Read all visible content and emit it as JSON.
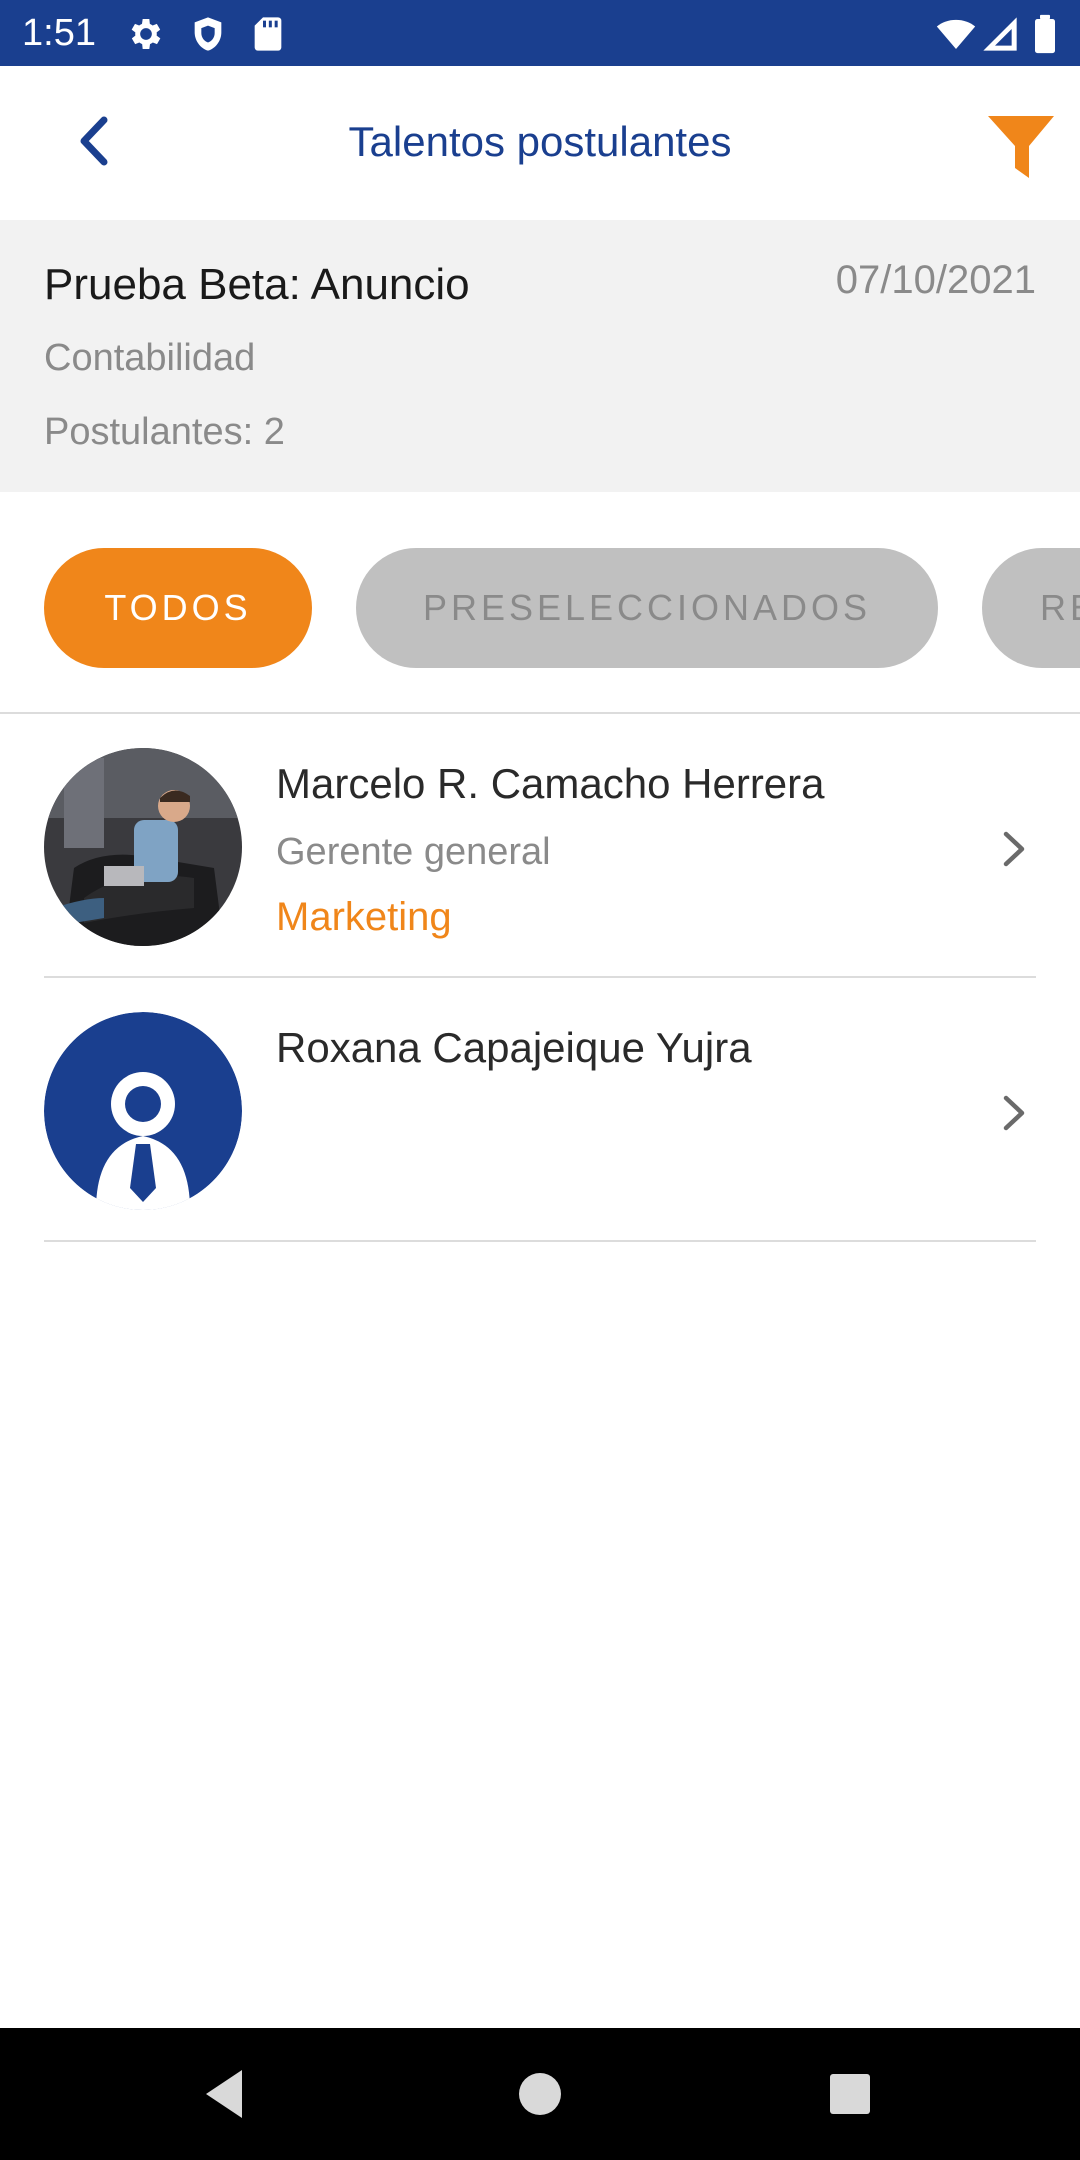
{
  "status_bar": {
    "time": "1:51",
    "icons": [
      "settings-icon",
      "shield-icon",
      "sd-card-icon",
      "wifi-icon",
      "signal-icon",
      "battery-icon"
    ],
    "background": "#1a3f8f"
  },
  "app_bar": {
    "title": "Talentos postulantes",
    "back_icon": "chevron-left-icon",
    "filter_icon": "filter-icon"
  },
  "job": {
    "title": "Prueba Beta: Anuncio",
    "date": "07/10/2021",
    "area": "Contabilidad",
    "applicants": "Postulantes: 2"
  },
  "tabs": [
    {
      "label": "TODOS",
      "active": true
    },
    {
      "label": "PRESELECCIONADOS",
      "active": false
    },
    {
      "label": "RE",
      "active": false
    }
  ],
  "candidates": [
    {
      "name": "Marcelo R. Camacho Herrera",
      "role": "Gerente general",
      "department": "Marketing",
      "avatar": "photo"
    },
    {
      "name": "Roxana Capajeique Yujra",
      "role": "",
      "department": "",
      "avatar": "default-user-icon"
    }
  ],
  "colors": {
    "primary": "#1a3f8f",
    "accent": "#f0861a",
    "muted": "#8a8a8a",
    "inactive_tab": "#c0c0c0"
  },
  "nav_bar": {
    "buttons": [
      "back-triangle-icon",
      "home-circle-icon",
      "recents-square-icon"
    ]
  }
}
